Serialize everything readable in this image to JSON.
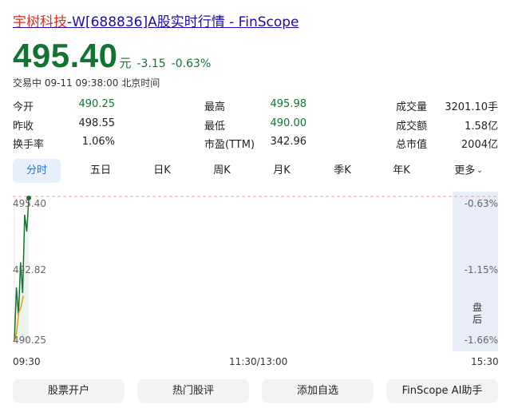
{
  "title": {
    "name": "宇树科技",
    "rest": "-W[688836]A股实时行情 - FinScope"
  },
  "quote": {
    "price": "495.40",
    "unit": "元",
    "change": "-3.15",
    "change_pct": "-0.63%",
    "status": "交易中 09-11 09:38:00 北京时间"
  },
  "stats": [
    {
      "label": "今开",
      "value": "490.25",
      "color": "green"
    },
    {
      "label": "最高",
      "value": "495.98",
      "color": "green"
    },
    {
      "label": "成交量",
      "value": "3201.10手",
      "color": "normal"
    },
    {
      "label": "昨收",
      "value": "498.55",
      "color": "normal"
    },
    {
      "label": "最低",
      "value": "490.00",
      "color": "green"
    },
    {
      "label": "成交额",
      "value": "1.58亿",
      "color": "normal"
    },
    {
      "label": "换手率",
      "value": "1.06%",
      "color": "normal"
    },
    {
      "label": "市盈(TTM)",
      "value": "342.96",
      "color": "normal"
    },
    {
      "label": "总市值",
      "value": "2004亿",
      "color": "normal"
    }
  ],
  "tabs": [
    "分时",
    "五日",
    "日K",
    "周K",
    "月K",
    "季K",
    "年K",
    "更多"
  ],
  "active_tab": 0,
  "chart_data": {
    "type": "line",
    "y_left_ticks": [
      "495.40",
      "492.82",
      "490.25"
    ],
    "y_right_ticks": [
      "-0.63%",
      "-1.15%",
      "-1.66%"
    ],
    "x_ticks": [
      "09:30",
      "11:30/13:00",
      "15:30"
    ],
    "reference_price": 498.55,
    "ylim": [
      490.25,
      495.4
    ],
    "after_hours_label": [
      "盘",
      "后"
    ],
    "series": [
      {
        "color": "#137333",
        "values": [
          490.25,
          492.2,
          491.2,
          493.1,
          492.0,
          494.8,
          494.2,
          495.4
        ]
      },
      {
        "color": "#f29900",
        "values": [
          490.25,
          490.6,
          491.3,
          491.5,
          491.9
        ]
      }
    ]
  },
  "buttons": [
    "股票开户",
    "热门股评",
    "添加自选",
    "FinScope AI助手"
  ],
  "colors": {
    "green": "#137333",
    "link": "#1a0dab",
    "red": "#d93025",
    "accent": "#1a73e8"
  }
}
